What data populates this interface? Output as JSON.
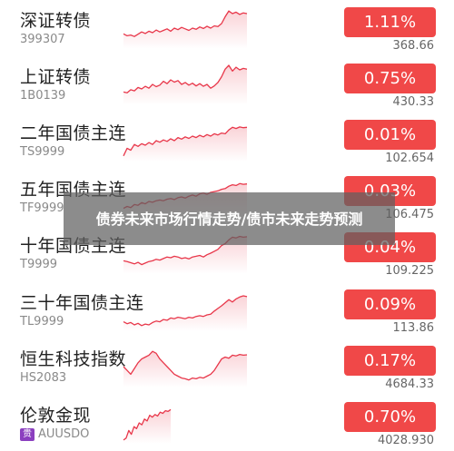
{
  "accent_color": "#f04848",
  "line_color": "#e8374a",
  "rows": [
    {
      "name": "深证转债",
      "code": "399307",
      "change": "1.11%",
      "price": "368.66",
      "badge": "",
      "spark": [
        0.35,
        0.3,
        0.32,
        0.28,
        0.34,
        0.4,
        0.36,
        0.42,
        0.38,
        0.45,
        0.4,
        0.44,
        0.48,
        0.42,
        0.5,
        0.46,
        0.52,
        0.48,
        0.44,
        0.5,
        0.47,
        0.53,
        0.49,
        0.55,
        0.5,
        0.56,
        0.54,
        0.62,
        0.8,
        0.95,
        0.88,
        0.92,
        0.86,
        0.9,
        0.88
      ]
    },
    {
      "name": "上证转债",
      "code": "1B0139",
      "change": "0.75%",
      "price": "430.33",
      "badge": "",
      "spark": [
        0.3,
        0.28,
        0.36,
        0.33,
        0.42,
        0.38,
        0.45,
        0.4,
        0.5,
        0.44,
        0.48,
        0.58,
        0.52,
        0.62,
        0.56,
        0.6,
        0.5,
        0.55,
        0.48,
        0.53,
        0.46,
        0.52,
        0.45,
        0.5,
        0.4,
        0.46,
        0.55,
        0.7,
        0.9,
        1.0,
        0.85,
        0.95,
        0.88,
        0.92,
        0.9
      ]
    },
    {
      "name": "二年国债主连",
      "code": "TS9999",
      "change": "0.01%",
      "price": "102.654",
      "badge": "",
      "spark": [
        0.1,
        0.3,
        0.25,
        0.4,
        0.35,
        0.42,
        0.38,
        0.45,
        0.4,
        0.5,
        0.46,
        0.52,
        0.48,
        0.55,
        0.5,
        0.58,
        0.54,
        0.6,
        0.56,
        0.62,
        0.58,
        0.64,
        0.6,
        0.66,
        0.62,
        0.68,
        0.65,
        0.7,
        0.68,
        0.78,
        0.85,
        0.82,
        0.86,
        0.84,
        0.85
      ]
    },
    {
      "name": "五年国债主连",
      "code": "TF9999",
      "change": "0.03%",
      "price": "106.475",
      "badge": "",
      "spark": [
        0.2,
        0.25,
        0.22,
        0.3,
        0.28,
        0.35,
        0.32,
        0.38,
        0.36,
        0.4,
        0.42,
        0.4,
        0.44,
        0.46,
        0.43,
        0.48,
        0.5,
        0.47,
        0.52,
        0.55,
        0.52,
        0.58,
        0.6,
        0.57,
        0.62,
        0.64,
        0.66,
        0.7,
        0.72,
        0.78,
        0.82,
        0.8,
        0.85,
        0.83,
        0.84
      ]
    },
    {
      "name": "十年国债主连",
      "code": "T9999",
      "change": "0.04%",
      "price": "109.225",
      "badge": "",
      "spark": [
        0.3,
        0.28,
        0.25,
        0.22,
        0.26,
        0.2,
        0.24,
        0.28,
        0.3,
        0.34,
        0.32,
        0.36,
        0.4,
        0.38,
        0.42,
        0.4,
        0.36,
        0.38,
        0.35,
        0.4,
        0.42,
        0.44,
        0.4,
        0.46,
        0.5,
        0.55,
        0.6,
        0.7,
        0.75,
        0.85,
        0.92,
        0.9,
        0.94,
        0.92,
        0.93
      ]
    },
    {
      "name": "三十年国债主连",
      "code": "TL9999",
      "change": "0.09%",
      "price": "113.86",
      "badge": "",
      "spark": [
        0.2,
        0.15,
        0.18,
        0.12,
        0.16,
        0.1,
        0.14,
        0.12,
        0.18,
        0.22,
        0.2,
        0.26,
        0.24,
        0.3,
        0.28,
        0.32,
        0.3,
        0.28,
        0.32,
        0.3,
        0.34,
        0.36,
        0.34,
        0.38,
        0.4,
        0.48,
        0.55,
        0.62,
        0.7,
        0.78,
        0.72,
        0.8,
        0.85,
        0.88,
        0.86
      ]
    },
    {
      "name": "恒生科技指数",
      "code": "HS2083",
      "change": "0.17%",
      "price": "4684.33",
      "badge": "",
      "spark": [
        0.5,
        0.4,
        0.3,
        0.45,
        0.6,
        0.7,
        0.75,
        0.8,
        0.9,
        0.85,
        0.7,
        0.6,
        0.5,
        0.4,
        0.3,
        0.25,
        0.2,
        0.18,
        0.15,
        0.2,
        0.18,
        0.22,
        0.2,
        0.25,
        0.3,
        0.4,
        0.55,
        0.7,
        0.75,
        0.72,
        0.8,
        0.78,
        0.82,
        0.8,
        0.81
      ]
    },
    {
      "name": "伦敦金现",
      "code": "AUUSDO",
      "change": "0.70%",
      "price": "4028.930",
      "badge": "贵",
      "spark": [
        0.05,
        0.1,
        0.3,
        0.2,
        0.4,
        0.35,
        0.5,
        0.45,
        0.6,
        0.55,
        0.7,
        0.65,
        0.72,
        0.68,
        0.78,
        0.75,
        0.82,
        0.8,
        0.85
      ]
    }
  ],
  "overlay_text": "债券未来市场行情走势/债市未来走势预测"
}
